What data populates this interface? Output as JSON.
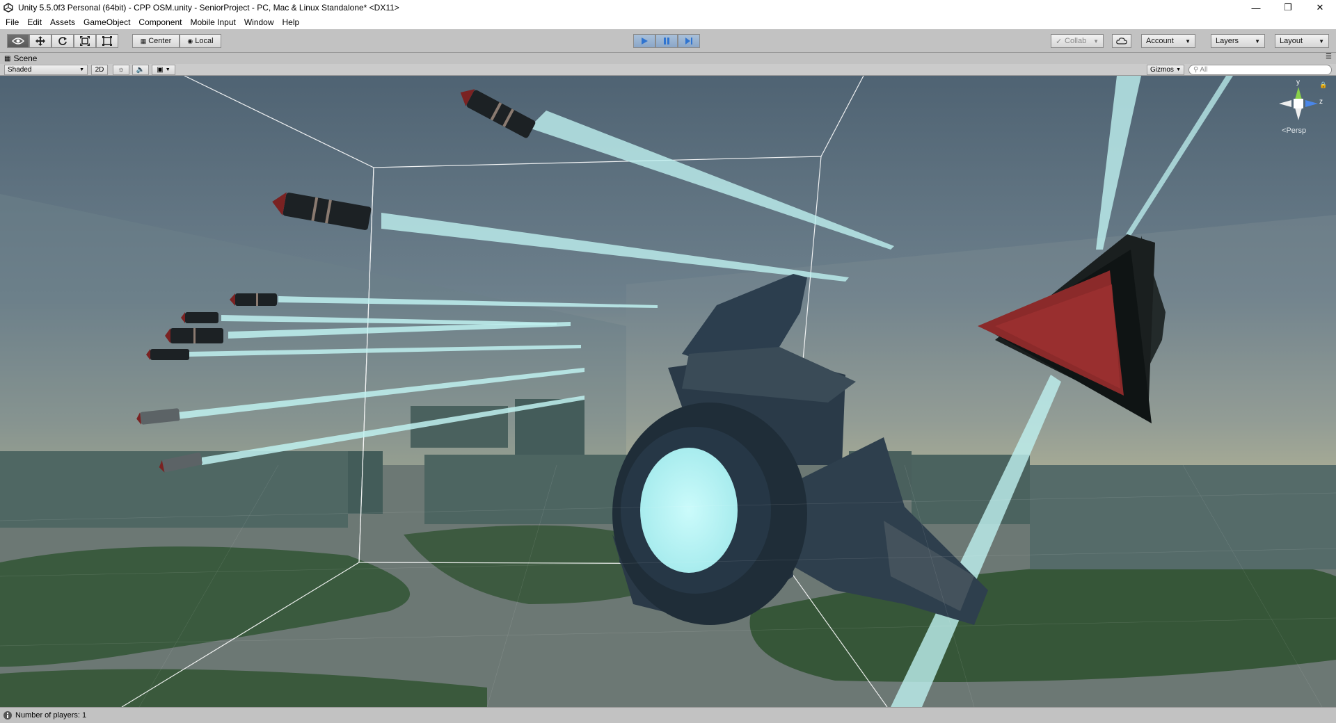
{
  "window": {
    "title": "Unity 5.5.0f3 Personal (64bit) - CPP OSM.unity - SeniorProject - PC, Mac & Linux Standalone* <DX11>",
    "minimize": "—",
    "restore": "❐",
    "close": "✕"
  },
  "menu": {
    "items": [
      "File",
      "Edit",
      "Assets",
      "GameObject",
      "Component",
      "Mobile Input",
      "Window",
      "Help"
    ]
  },
  "toolbar": {
    "pivot_label": "Center",
    "space_label": "Local",
    "collab_label": "Collab",
    "account_label": "Account",
    "layers_label": "Layers",
    "layout_label": "Layout"
  },
  "scene": {
    "tab_label": "Scene",
    "shading_mode": "Shaded",
    "mode_2d": "2D",
    "gizmos_label": "Gizmos",
    "search_placeholder": "All",
    "projection_label": "Persp",
    "axis_y": "y",
    "axis_z": "z"
  },
  "status": {
    "message": "Number of players: 1"
  },
  "colors": {
    "play_accent": "#3b7dd8",
    "beam": "#bff1f0",
    "ship_body": "#2a3d4d",
    "ship_glow": "#bdf6f6",
    "triangle_red": "#8b2a2a"
  }
}
